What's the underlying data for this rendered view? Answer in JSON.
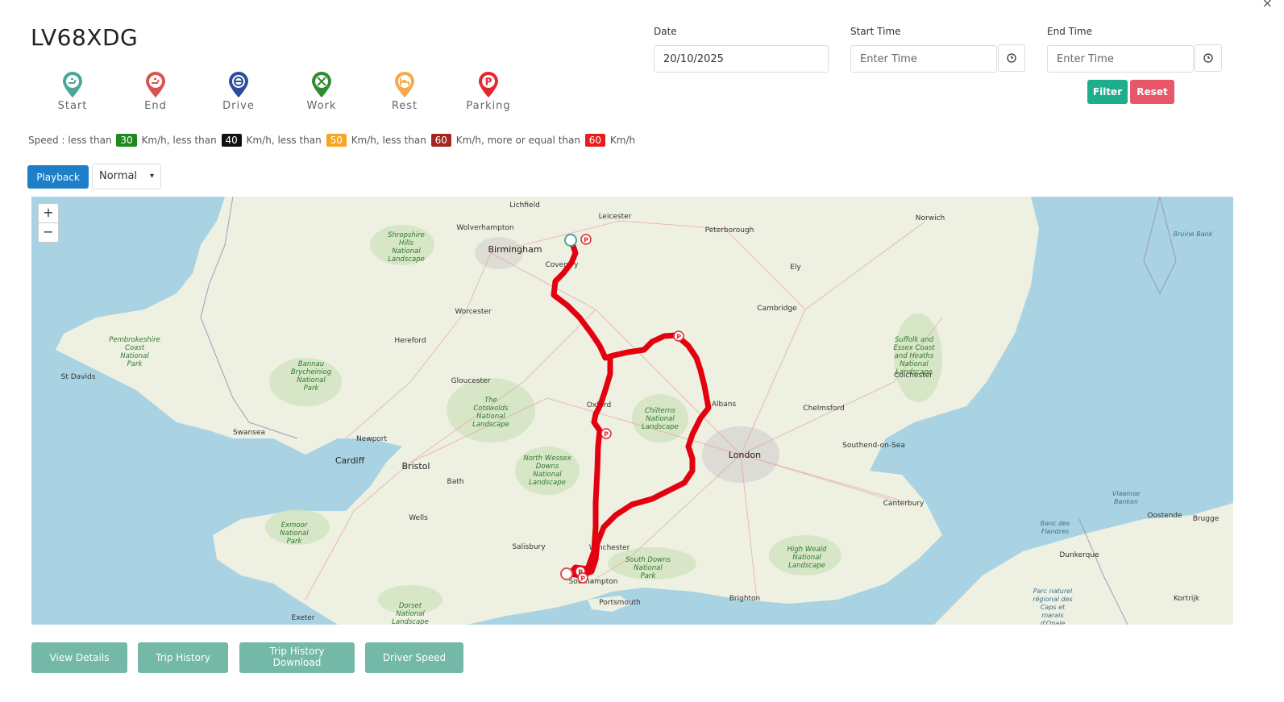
{
  "vehicle": {
    "registration": "LV68XDG"
  },
  "legend": [
    {
      "label": "Start",
      "icon": "start-pin-icon",
      "color": "#4aa79a"
    },
    {
      "label": "End",
      "icon": "end-pin-icon",
      "color": "#d9534f"
    },
    {
      "label": "Drive",
      "icon": "drive-pin-icon",
      "color": "#2c4c9b"
    },
    {
      "label": "Work",
      "icon": "work-pin-icon",
      "color": "#2e8b2e"
    },
    {
      "label": "Rest",
      "icon": "rest-pin-icon",
      "color": "#f5a94a"
    },
    {
      "label": "Parking",
      "icon": "parking-pin-icon",
      "color": "#e3262f"
    }
  ],
  "speed_legend": {
    "prefix": "Speed : less than",
    "sep1": "Km/h, less than",
    "sep2": "Km/h, less than",
    "sep3": "Km/h, less than",
    "sep4": "Km/h, more or equal than",
    "suffix": "Km/h",
    "thresholds": [
      {
        "value": "30",
        "color": "#1e8a1e"
      },
      {
        "value": "40",
        "color": "#111111"
      },
      {
        "value": "50",
        "color": "#f5a623"
      },
      {
        "value": "60",
        "color": "#a3271f"
      },
      {
        "value": "60",
        "color": "#e81c1c"
      }
    ]
  },
  "controls": {
    "playback_label": "Playback",
    "speed_selected": "Normal"
  },
  "filters": {
    "date_label": "Date",
    "date_value": "20/10/2025",
    "start_time_label": "Start Time",
    "start_time_placeholder": "Enter Time",
    "end_time_label": "End Time",
    "end_time_placeholder": "Enter Time",
    "filter_label": "Filter",
    "reset_label": "Reset"
  },
  "map": {
    "zoom_in": "+",
    "zoom_out": "−",
    "route_color": "#e3000f",
    "places": [
      "Lichfield",
      "Leicester",
      "Peterborough",
      "Norwich",
      "Wolverhampton",
      "Birmingham",
      "Coventry",
      "Ely",
      "Cambridge",
      "Worcester",
      "Hereford",
      "St Davids",
      "Gloucester",
      "Colchester",
      "Chelmsford",
      "Albans",
      "Oxford",
      "Swansea",
      "Newport",
      "Cardiff",
      "Bristol",
      "Bath",
      "London",
      "Southend-on-Sea",
      "Wells",
      "Canterbury",
      "Salisbury",
      "Winchester",
      "Southampton",
      "Portsmouth",
      "Brighton",
      "Exeter",
      "Oostende",
      "Brugge",
      "Dunkerque",
      "Kortrijk"
    ],
    "areas": [
      "Shropshire Hills National Landscape",
      "Pembrokeshire Coast National Park",
      "Bannau Brycheiniog National Park",
      "The Cotswolds National Landscape",
      "Chilterns National Landscape",
      "North Wessex Downs National Landscape",
      "Suffolk and Essex Coast and Heaths National Landscape",
      "Exmoor National Park",
      "South Downs National Park",
      "High Weald National Landscape",
      "Dorset National Landscape",
      "Bruine Bank",
      "Vlaamse Banken",
      "Banc des Flandres",
      "Parc naturel régional des Caps et marais d'Opale"
    ]
  },
  "actions": {
    "view_details": "View Details",
    "trip_history": "Trip History",
    "trip_history_download": "Trip History Download",
    "driver_speed": "Driver Speed"
  }
}
